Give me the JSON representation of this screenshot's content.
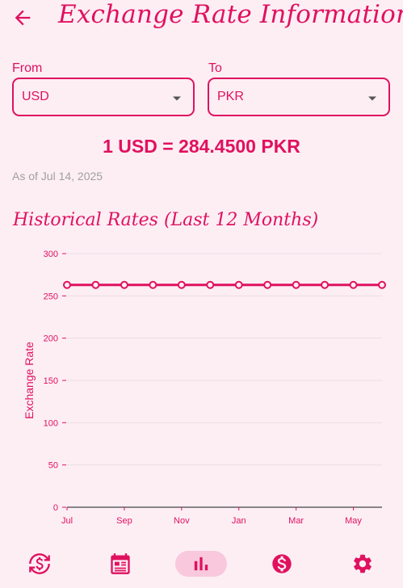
{
  "app": {
    "title": "Exchange Rate Information"
  },
  "from": {
    "label": "From",
    "value": "USD"
  },
  "to": {
    "label": "To",
    "value": "PKR"
  },
  "rate": {
    "text": "1 USD = 284.4500 PKR"
  },
  "as_of": "As of Jul 14, 2025",
  "history": {
    "title": "Historical Rates (Last 12 Months)"
  },
  "colors": {
    "accent": "#e0115f",
    "background": "#fdeef4",
    "nav_active": "#f9c8dc",
    "muted": "#a0a0a0"
  },
  "nav": {
    "items": [
      {
        "icon": "currency-exchange-icon"
      },
      {
        "icon": "calendar-icon"
      },
      {
        "icon": "bar-chart-icon",
        "active": true
      },
      {
        "icon": "dollar-circle-icon"
      },
      {
        "icon": "settings-gear-icon"
      }
    ]
  },
  "chart_data": {
    "type": "line",
    "ylabel": "Exchange Rate",
    "xlabel": "",
    "x_tick_labels": [
      "Jul",
      "Sep",
      "Nov",
      "Jan",
      "Mar",
      "May"
    ],
    "y_ticks": [
      0,
      50,
      100,
      150,
      200,
      250,
      300
    ],
    "ylim": [
      0,
      300
    ],
    "grid": true,
    "legend": "none",
    "series": [
      {
        "values": [
          263,
          263,
          263,
          263,
          263,
          263,
          263,
          263,
          263,
          263,
          263,
          263
        ]
      }
    ]
  }
}
